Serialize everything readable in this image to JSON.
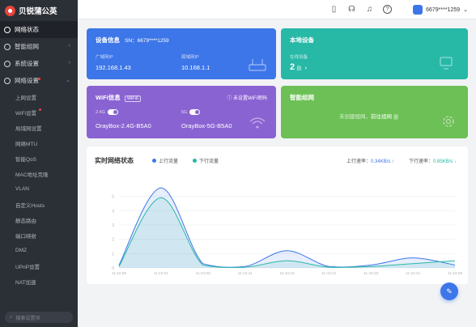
{
  "brand": {
    "name": "贝锐蒲公英"
  },
  "sidebar": {
    "items": [
      {
        "label": "网络状态",
        "icon": "globe-icon",
        "active": true
      },
      {
        "label": "智能组网",
        "icon": "network-icon"
      },
      {
        "label": "系统设置",
        "icon": "gear-icon"
      },
      {
        "label": "网络设置",
        "icon": "settings-icon",
        "expanded": true
      }
    ],
    "subitems": [
      "上网设置",
      "WiFi设置",
      "局域网设置",
      "网络MTU",
      "智能QoS",
      "MAC地址克隆",
      "VLAN",
      "自定义Hosts",
      "静态路由",
      "端口映射",
      "DMZ",
      "UPnP设置",
      "NAT加速"
    ],
    "search_placeholder": "搜索设置项"
  },
  "topbar": {
    "user": "6679****1259"
  },
  "device_card": {
    "title": "设备信息",
    "sn_label": "SN：6679****1259",
    "wan_label": "广域网IP",
    "wan_value": "192.168.1.43",
    "lan_label": "局域网IP",
    "lan_value": "10.168.1.1",
    "color": "#3d76e8"
  },
  "local_card": {
    "title": "本地设备",
    "count_label": "在线设备",
    "count_value": "2",
    "count_unit": "台",
    "color": "#27b8a6"
  },
  "wifi_card": {
    "title": "WiFi信息",
    "wifi_tag": "WiFi6",
    "pwd_hint": "未设置WiFi密码",
    "band1": "2.4G",
    "band2": "5G",
    "ssid1": "OrayBox-2.4G-B5A0",
    "ssid2": "OrayBox-5G-B5A0",
    "color": "#8a63d2"
  },
  "mesh_card": {
    "title": "智能组网",
    "text": "未创建组网，",
    "link": "前往组网",
    "color": "#6cc055"
  },
  "chart_header": {
    "title": "实时网络状态",
    "up_rate_label": "上行速率：",
    "up_rate": "0.34KB/s",
    "down_rate_label": "下行速率：",
    "down_rate": "0.85KB/s"
  },
  "chart_data": {
    "type": "area",
    "x": [
      "11:42:58",
      "11:43:01",
      "11:43:06",
      "11:43:11",
      "11:43:16",
      "11:43:21",
      "11:43:26",
      "11:43:31",
      "11:43:36"
    ],
    "ylim": [
      0,
      6
    ],
    "yticks": [
      0,
      1,
      2,
      3,
      4,
      5
    ],
    "series": [
      {
        "name": "上行流量",
        "color": "#3d76e8",
        "values": [
          0.2,
          5.6,
          0.3,
          0.1,
          1.2,
          0.1,
          0.2,
          0.7,
          0.2
        ]
      },
      {
        "name": "下行流量",
        "color": "#27b8a6",
        "values": [
          0.1,
          4.9,
          0.2,
          0.05,
          0.5,
          0.05,
          0.1,
          0.3,
          0.5
        ]
      }
    ]
  }
}
